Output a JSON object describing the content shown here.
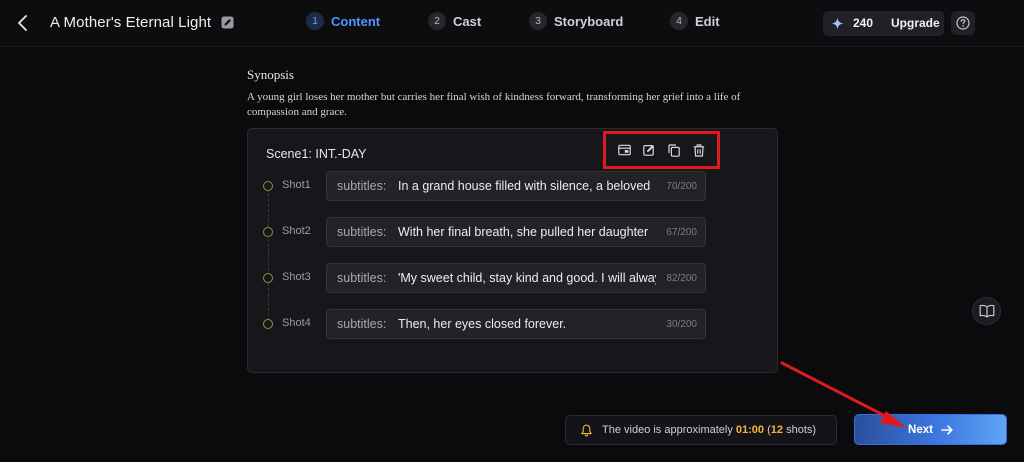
{
  "header": {
    "project_title": "A Mother's Eternal Light",
    "steps": [
      {
        "num": "1",
        "label": "Content",
        "active": true
      },
      {
        "num": "2",
        "label": "Cast",
        "active": false
      },
      {
        "num": "3",
        "label": "Storyboard",
        "active": false
      },
      {
        "num": "4",
        "label": "Edit",
        "active": false
      }
    ],
    "credits": "240",
    "upgrade_label": "Upgrade"
  },
  "synopsis": {
    "title": "Synopsis",
    "text": "A young girl loses her mother but carries her final wish of kindness forward, transforming her grief into a life of compassion and grace."
  },
  "scene": {
    "title": "Scene1: INT.-DAY",
    "tools": [
      "scene-card-icon",
      "edit-icon",
      "copy-icon",
      "trash-icon"
    ],
    "shots": [
      {
        "label": "Shot1",
        "key": "subtitles:",
        "text": "In a grand house filled with silence, a beloved",
        "count": "70/200"
      },
      {
        "label": "Shot2",
        "key": "subtitles:",
        "text": "With her final breath, she pulled her daughter",
        "count": "67/200"
      },
      {
        "label": "Shot3",
        "key": "subtitles:",
        "text": "'My sweet child, stay kind and good. I will always",
        "count": "82/200"
      },
      {
        "label": "Shot4",
        "key": "subtitles:",
        "text": "Then, her eyes closed forever.",
        "count": "30/200"
      }
    ]
  },
  "footer": {
    "duration_prefix": "The video is approximately ",
    "duration_value": "01:00",
    "shots_open": " (",
    "shots_value": "12",
    "shots_suffix": " shots)",
    "next_label": "Next"
  },
  "colors": {
    "accent": "#4f97ff",
    "highlight": "#f2b43a",
    "annotation": "#e0191f"
  }
}
